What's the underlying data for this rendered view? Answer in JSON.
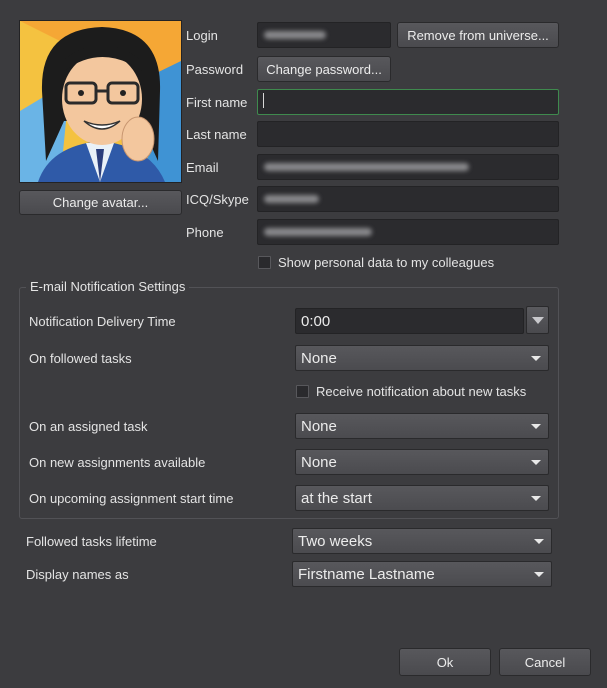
{
  "profile": {
    "change_avatar_label": "Change avatar...",
    "login_label": "Login",
    "password_label": "Password",
    "first_name_label": "First name",
    "last_name_label": "Last name",
    "email_label": "Email",
    "icq_label": "ICQ/Skype",
    "phone_label": "Phone",
    "remove_label": "Remove from universe...",
    "change_password_label": "Change password...",
    "first_name_value": "",
    "last_name_value": "",
    "show_personal_label": "Show personal data to my colleagues"
  },
  "notifications": {
    "group_title": "E-mail Notification Settings",
    "delivery_time_label": "Notification Delivery Time",
    "delivery_time_value": "0:00",
    "followed_label": "On followed tasks",
    "followed_value": "None",
    "receive_new_label": "Receive notification about new tasks",
    "assigned_label": "On an assigned task",
    "assigned_value": "None",
    "new_assignments_label": "On new assignments available",
    "new_assignments_value": "None",
    "upcoming_label": "On upcoming assignment start time",
    "upcoming_value": "at the start"
  },
  "general": {
    "lifetime_label": "Followed tasks lifetime",
    "lifetime_value": "Two weeks",
    "display_names_label": "Display names as",
    "display_names_value": "Firstname Lastname"
  },
  "footer": {
    "ok_label": "Ok",
    "cancel_label": "Cancel"
  },
  "colors": {
    "background": "#3c3c3f",
    "field": "#2b2b2e",
    "focus_border": "#3f8a4e"
  },
  "icons": {
    "avatar": "cartoon-avatar",
    "dropdown": "chevron-down-icon",
    "spin": "spin-down-icon"
  }
}
